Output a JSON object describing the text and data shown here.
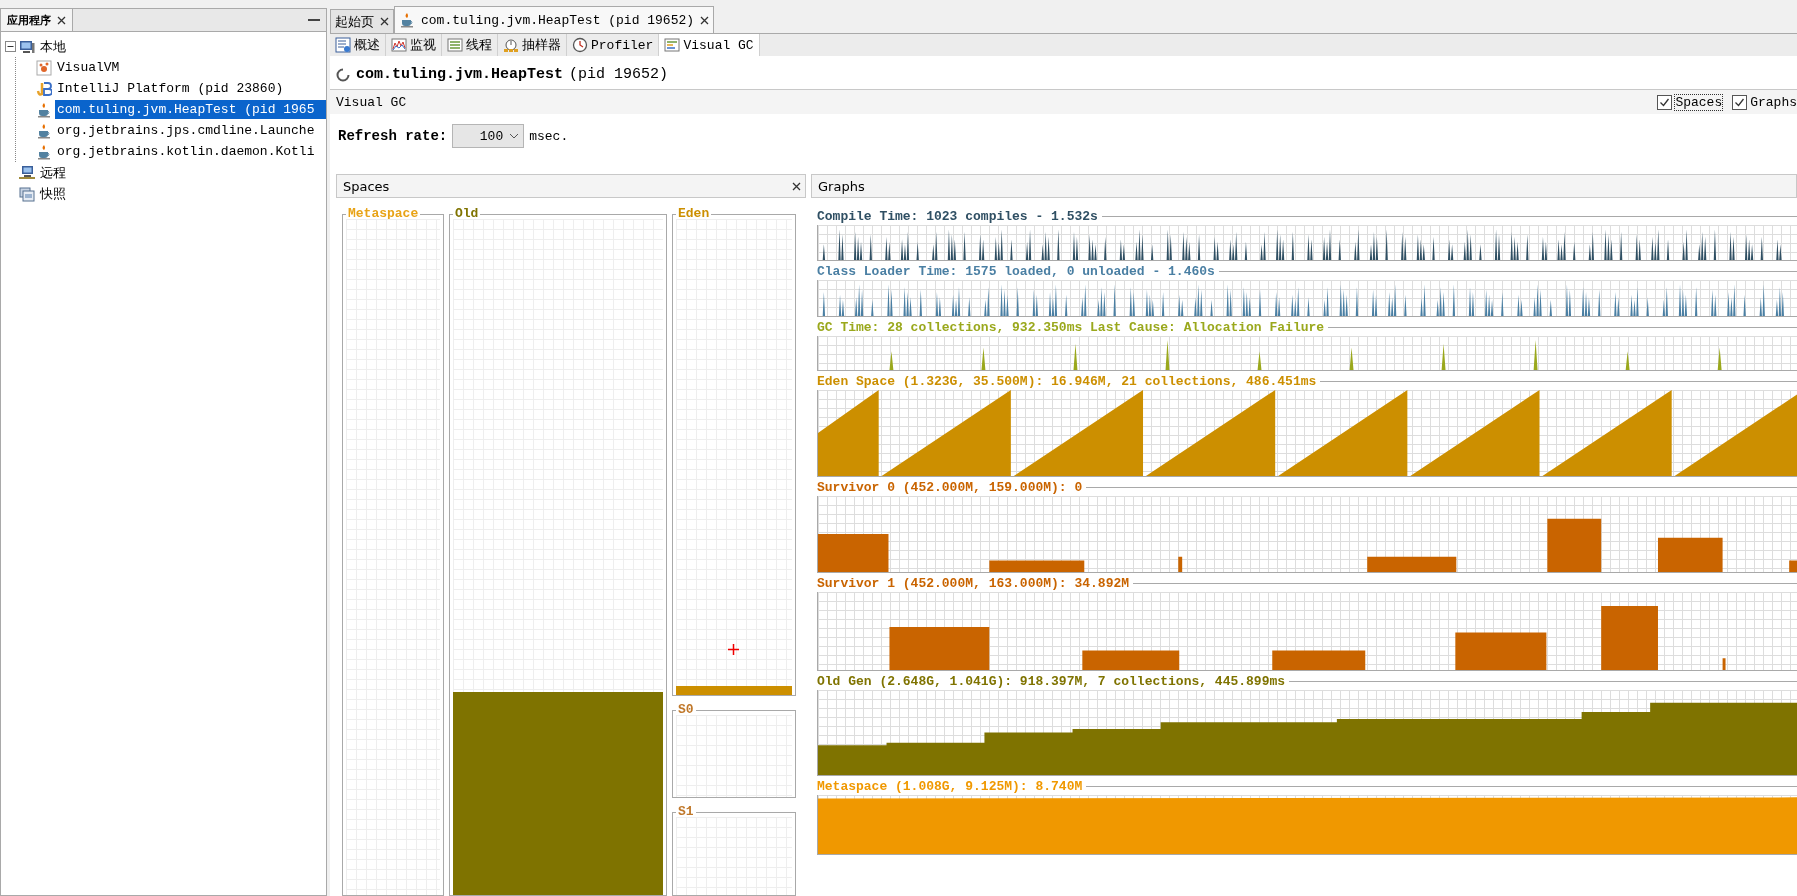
{
  "left_panel": {
    "tab": "应用程序",
    "tree": [
      {
        "label": "本地",
        "kind": "host",
        "selected": false,
        "expanded": true,
        "children": [
          {
            "label": "VisualVM",
            "kind": "visualvm",
            "selected": false
          },
          {
            "label": "IntelliJ Platform (pid 23860)",
            "kind": "intellij",
            "selected": false
          },
          {
            "label": "com.tuling.jvm.HeapTest (pid 1965",
            "kind": "java",
            "selected": true
          },
          {
            "label": "org.jetbrains.jps.cmdline.Launche",
            "kind": "java",
            "selected": false
          },
          {
            "label": "org.jetbrains.kotlin.daemon.Kotli",
            "kind": "java",
            "selected": false
          }
        ]
      },
      {
        "label": "远程",
        "kind": "remote",
        "selected": false
      },
      {
        "label": "快照",
        "kind": "snapshot",
        "selected": false
      }
    ]
  },
  "document_tabs": [
    {
      "label": "起始页",
      "kind": "start",
      "selected": false
    },
    {
      "label": "com.tuling.jvm.HeapTest (pid 19652)",
      "kind": "java",
      "selected": true
    }
  ],
  "view_tabs": [
    {
      "label": "概述",
      "kind": "overview",
      "selected": false
    },
    {
      "label": "监视",
      "kind": "monitor",
      "selected": false
    },
    {
      "label": "线程",
      "kind": "threads",
      "selected": false
    },
    {
      "label": "抽样器",
      "kind": "sampler",
      "selected": false
    },
    {
      "label": "Profiler",
      "kind": "profiler",
      "selected": false
    },
    {
      "label": "Visual GC",
      "kind": "visualgc",
      "selected": true
    }
  ],
  "app_title": {
    "name": "com.tuling.jvm.HeapTest",
    "pid": "(pid 19652)"
  },
  "section_bar": {
    "title": "Visual GC",
    "checkboxes": [
      {
        "label": "Spaces",
        "checked": true
      },
      {
        "label": "Graphs",
        "checked": true
      }
    ]
  },
  "refresh": {
    "label": "Refresh rate:",
    "value": "100",
    "unit": "msec."
  },
  "spaces_panel": {
    "title": "Spaces",
    "spaces": [
      {
        "name": "Metaspace",
        "color": "#e8a317"
      },
      {
        "name": "Old",
        "color": "#7f7300",
        "level": 0.3
      },
      {
        "name": "Eden",
        "color": "#cc8f00",
        "level": 0.018
      },
      {
        "name": "S0",
        "color": "#c0782a"
      },
      {
        "name": "S1",
        "color": "#c0782a"
      }
    ]
  },
  "graphs_panel": {
    "title": "Graphs",
    "graphs": [
      {
        "title": "Compile Time: 1023 compiles - 1.532s",
        "kind": "spikes",
        "color": "#2f4f63"
      },
      {
        "title": "Class Loader Time: 1575 loaded, 0 unloaded - 1.460s",
        "kind": "spikes",
        "color": "#4a7fa3"
      },
      {
        "title": "GC Time: 28 collections, 932.350ms Last Cause: Allocation Failure",
        "kind": "gc",
        "color": "#9aa81c"
      },
      {
        "title": "Eden Space (1.323G, 35.500M): 16.946M, 21 collections, 486.451ms",
        "kind": "sawtooth",
        "color": "#cc8f00"
      },
      {
        "title": "Survivor 0 (452.000M, 159.000M): 0",
        "kind": "blocks",
        "color": "#c96400"
      },
      {
        "title": "Survivor 1 (452.000M, 163.000M): 34.892M",
        "kind": "blocks",
        "color": "#c96400"
      },
      {
        "title": "Old Gen (2.648G, 1.041G): 918.397M, 7 collections, 445.899ms",
        "kind": "steps",
        "color": "#7f7300"
      },
      {
        "title": "Metaspace (1.008G, 9.125M): 8.740M",
        "kind": "fill",
        "color": "#f09800"
      }
    ]
  }
}
